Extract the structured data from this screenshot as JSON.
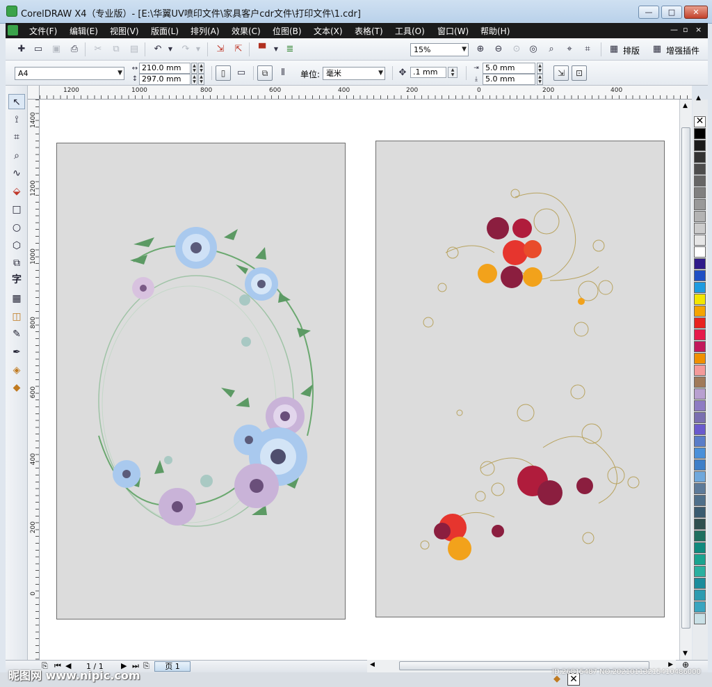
{
  "window": {
    "title": "CorelDRAW X4（专业版）- [E:\\华翼UV喷印文件\\家具客户cdr文件\\打印文件\\1.cdr]",
    "min_label": "—",
    "max_label": "□",
    "close_label": "✕"
  },
  "menu": {
    "items": [
      "文件(F)",
      "编辑(E)",
      "视图(V)",
      "版面(L)",
      "排列(A)",
      "效果(C)",
      "位图(B)",
      "文本(X)",
      "表格(T)",
      "工具(O)",
      "窗口(W)",
      "帮助(H)"
    ],
    "doc_controls": [
      "—",
      "▫",
      "×"
    ]
  },
  "toolbar": {
    "zoom": "15%",
    "layout_label": "排版",
    "plugin_label": "增强插件"
  },
  "property_bar": {
    "paper_size": "A4",
    "width": "210.0 mm",
    "height": "297.0 mm",
    "units_label": "单位:",
    "units_value": "毫米",
    "nudge": ".1 mm",
    "dup_x": "5.0 mm",
    "dup_y": "5.0 mm"
  },
  "ruler": {
    "top_labels": [
      "1200",
      "1000",
      "800",
      "600",
      "400",
      "200",
      "0",
      "200",
      "400"
    ],
    "left_labels": [
      "1400",
      "1200",
      "1000",
      "800",
      "600",
      "400",
      "200",
      "0"
    ]
  },
  "status": {
    "page_counter": "1 / 1",
    "page_tab": "页 1"
  },
  "palette": [
    "#ffffff",
    "#000000",
    "#1a1a1a",
    "#333333",
    "#4d4d4d",
    "#666666",
    "#808080",
    "#999999",
    "#b3b3b3",
    "#cccccc",
    "#e6e6e6",
    "#ffffff",
    "#2e1a8a",
    "#1f4fc4",
    "#1e9be0",
    "#f2e600",
    "#f5a400",
    "#e8231f",
    "#e6194b",
    "#c2185b",
    "#f09000",
    "#f49a9a",
    "#a07a5a",
    "#b8a0d0",
    "#8e7cc3",
    "#7a6fb0",
    "#6a5acd",
    "#5a7dc8",
    "#4a90d9",
    "#3d7fc8",
    "#6fa8dc",
    "#5d7a99",
    "#4f6f8a",
    "#3b5b70",
    "#2f4f4f",
    "#1f6f5f",
    "#118a7e",
    "#1aa38f",
    "#2ab0a0",
    "#1b8c9c",
    "#2d9bb0",
    "#3aa5c0",
    "#c9e0e6"
  ],
  "watermark": {
    "site": "昵图网 www.nipic.com",
    "id": "ID:26815487 NO:20210113215410486000"
  }
}
